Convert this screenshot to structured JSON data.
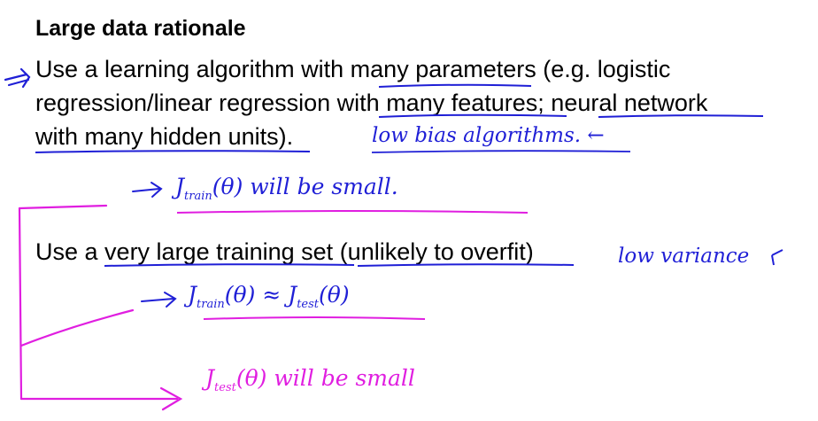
{
  "slide": {
    "title": "Large data rationale",
    "bullet1": {
      "line1_pre": "Use a learning algorithm with ",
      "line1_u": "many parameters",
      "line1_post": " (e.g. logistic",
      "line2_pre": "regression/linear regression ",
      "line2_u1": "with many features",
      "line2_mid": "; ",
      "line2_u2": "neural network",
      "line3_u": "with many hidden units",
      "line3_post": ")."
    },
    "bullet2": {
      "pre": "Use a ",
      "u1": "very large training set",
      "mid": " ",
      "u2": "(unlikely to overfit)"
    }
  },
  "annotations": {
    "low_bias": "low bias algorithms. ←",
    "jtrain_small_J": "J",
    "jtrain_small_sub": "train",
    "jtrain_small_rest": "(θ)  will  be  small.",
    "low_variance": "low variance",
    "jtrain_approx_J1": "J",
    "jtrain_approx_sub1": "train",
    "jtrain_approx_mid": "(θ) ≈ J",
    "jtrain_approx_sub2": "test",
    "jtrain_approx_end": "(θ)",
    "jtest_small_J": "J",
    "jtest_small_sub": "test",
    "jtest_small_rest": "(θ)   will  be  small",
    "arrow": "→"
  },
  "colors": {
    "blue_ink": "#1f1fd6",
    "magenta_ink": "#e01ee0",
    "text": "#000000",
    "background": "#ffffff"
  }
}
